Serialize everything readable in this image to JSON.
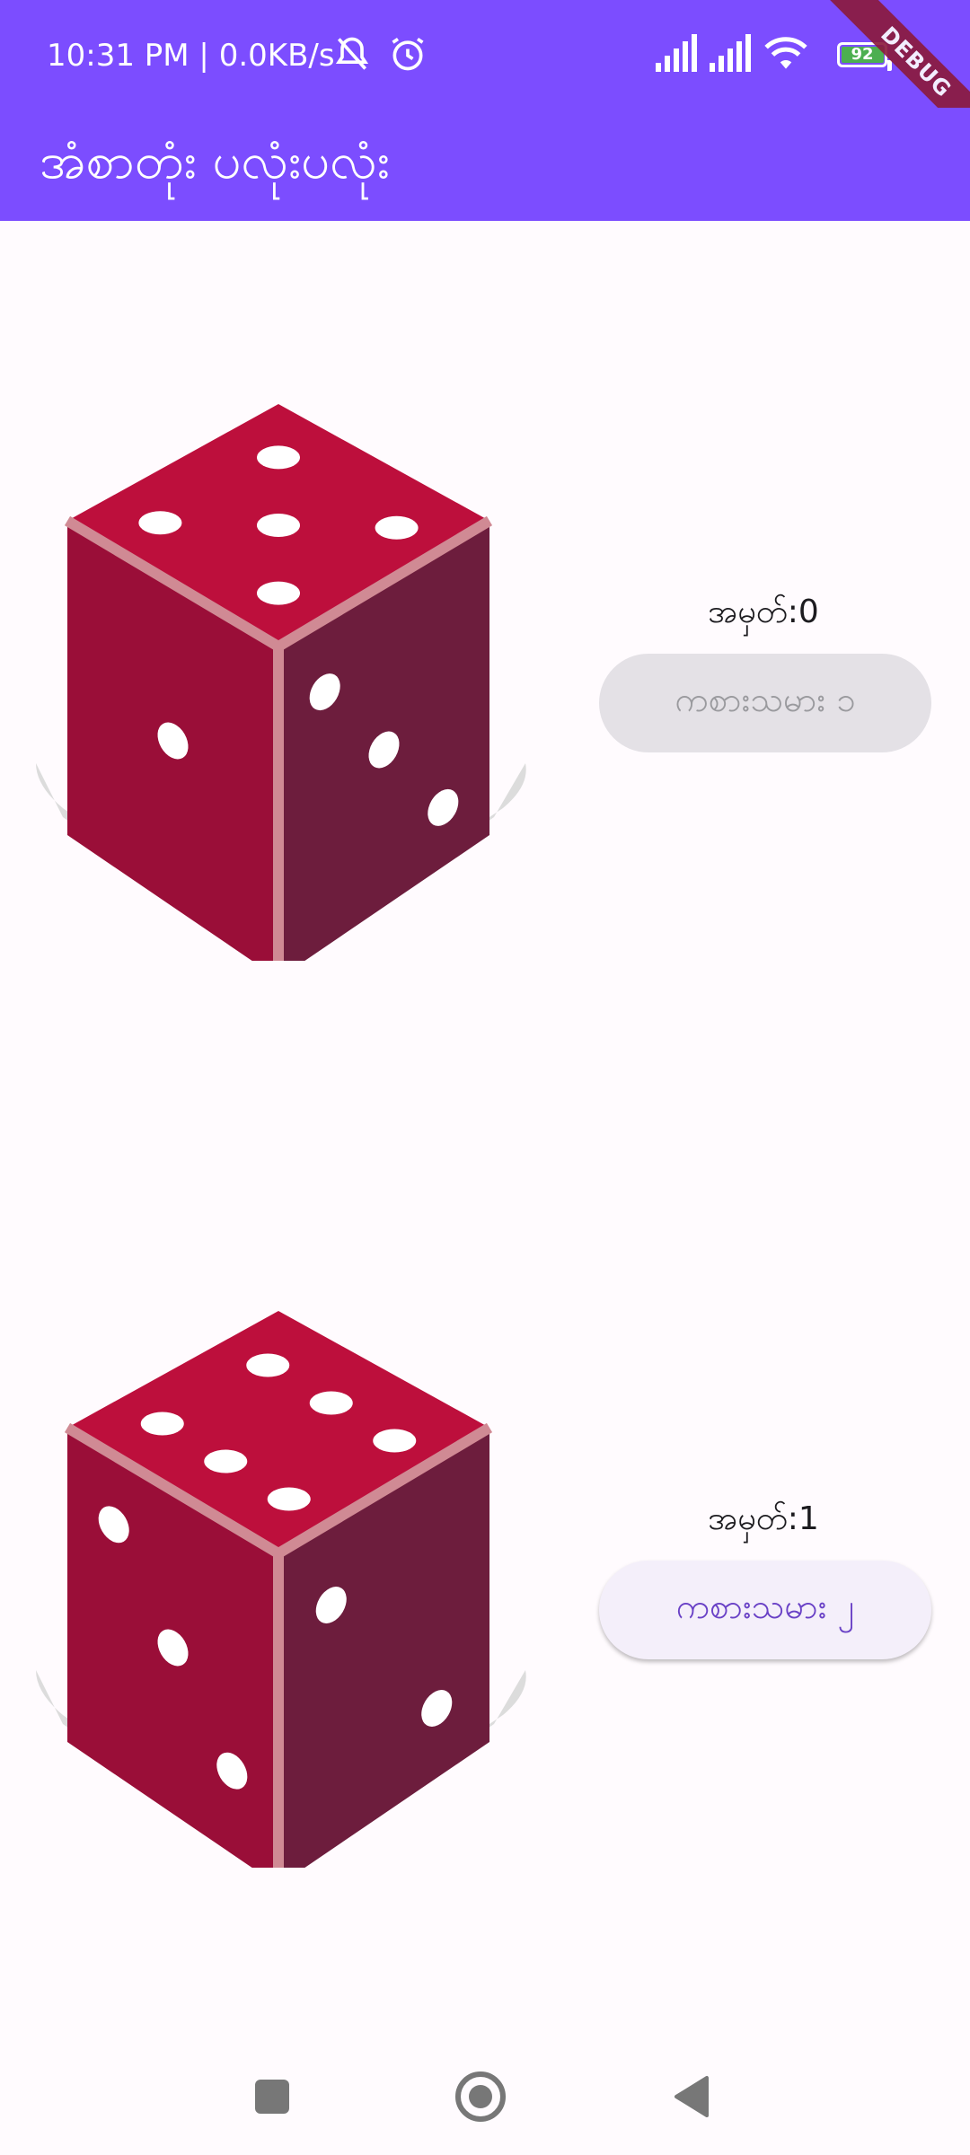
{
  "status_bar": {
    "time_text": "10:31 PM | 0.0KB/s",
    "battery_percent": "92",
    "battery_level": 0.92,
    "icons": [
      "silent-icon",
      "alarm-icon",
      "signal-icon",
      "signal-icon",
      "wifi-icon",
      "battery-icon"
    ]
  },
  "debug_banner": "DEBUG",
  "app_bar": {
    "title": "အံစာတုံး ပလုံးပလုံး",
    "color": "#7c4dff"
  },
  "players": [
    {
      "die_top_face": 5,
      "die_left_face": 1,
      "die_right_face": 3,
      "score_label": "အမှတ်:0",
      "button_label": "ကစားသမား ၁",
      "button_enabled": false
    },
    {
      "die_top_face": 6,
      "die_left_face": 3,
      "die_right_face": 2,
      "score_label": "အမှတ်:1",
      "button_label": "ကစားသမား ၂",
      "button_enabled": true
    }
  ],
  "colors": {
    "die_top": "#bd0f3c",
    "die_left": "#9a0e38",
    "die_right": "#6d1d3d",
    "die_edge": "#d08a94",
    "shadow": "#dcdcdc",
    "accent": "#6941c6"
  },
  "nav_bar": {
    "buttons": [
      "recents-square-icon",
      "home-circle-icon",
      "back-triangle-icon"
    ]
  }
}
